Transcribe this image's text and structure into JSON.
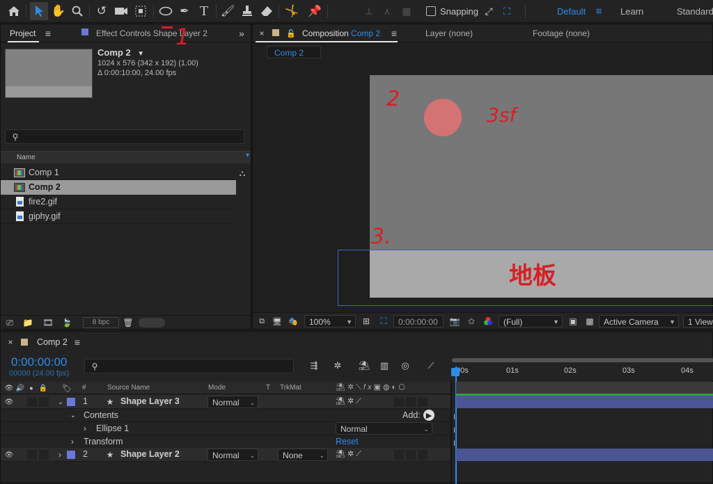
{
  "toolbar": {
    "snapping_label": "Snapping",
    "workspaces": [
      "Default",
      "Learn",
      "Standard"
    ],
    "icons": [
      "home-icon",
      "selection-arrow-icon",
      "hand-icon",
      "zoom-icon",
      "rotate-icon",
      "camera-icon",
      "pan-behind-icon",
      "ellipse-tool-icon",
      "pen-icon",
      "type-icon",
      "brush-icon",
      "stamp-icon",
      "eraser-icon",
      "puppet-icon",
      "pin-icon"
    ]
  },
  "project_panel": {
    "tab_project": "Project",
    "tab_effect_controls": "Effect Controls Shape Layer 2",
    "thumb_name": "Comp 2",
    "thumb_info_1": "1024 x 576  (342 x 192) (1.00)",
    "thumb_info_2": "Δ 0:00:10:00, 24.00 fps",
    "column_name": "Name",
    "items": [
      {
        "name": "Comp 1",
        "type": "comp"
      },
      {
        "name": "Comp 2",
        "type": "comp"
      },
      {
        "name": "fire2.gif",
        "type": "file"
      },
      {
        "name": "giphy.gif",
        "type": "file"
      }
    ],
    "bpc": "8 bpc"
  },
  "composition_panel": {
    "tab_comp_prefix": "Composition",
    "tab_comp_name": "Comp 2",
    "tab_layer": "Layer  (none)",
    "tab_footage": "Footage  (none)",
    "breadcrumb": "Comp 2",
    "zoom": "100%",
    "timecode": "0:00:00:00",
    "resolution": "(Full)",
    "camera": "Active Camera",
    "view": "1 View"
  },
  "annotations": {
    "mark_1": "1",
    "mark_2": "2",
    "mark_3": "3.",
    "mark_small": "3sf",
    "mark_floor": "地板"
  },
  "timeline": {
    "tab_name": "Comp 2",
    "current_time": "0:00:00:00",
    "frames_fps": "00000 (24.00 fps)",
    "col_hash": "#",
    "col_source": "Source Name",
    "col_mode": "Mode",
    "col_t": "T",
    "col_trkmat": "TrkMat",
    "ruler": [
      "00s",
      "01s",
      "02s",
      "03s",
      "04s"
    ],
    "layers": [
      {
        "num": "1",
        "name": "Shape Layer 3",
        "mode": "Normal",
        "trkmat": ""
      },
      {
        "num": "2",
        "name": "Shape Layer 2",
        "mode": "Normal",
        "trkmat": "None"
      }
    ],
    "contents_label": "Contents",
    "add_label": "Add:",
    "ellipse_label": "Ellipse 1",
    "ellipse_mode": "Normal",
    "transform_label": "Transform",
    "reset_label": "Reset"
  },
  "colors": {
    "accent": "#2d8ceb",
    "layer_label": "#6b78d8",
    "bar": "#4b5595",
    "circle": "#d47373"
  }
}
